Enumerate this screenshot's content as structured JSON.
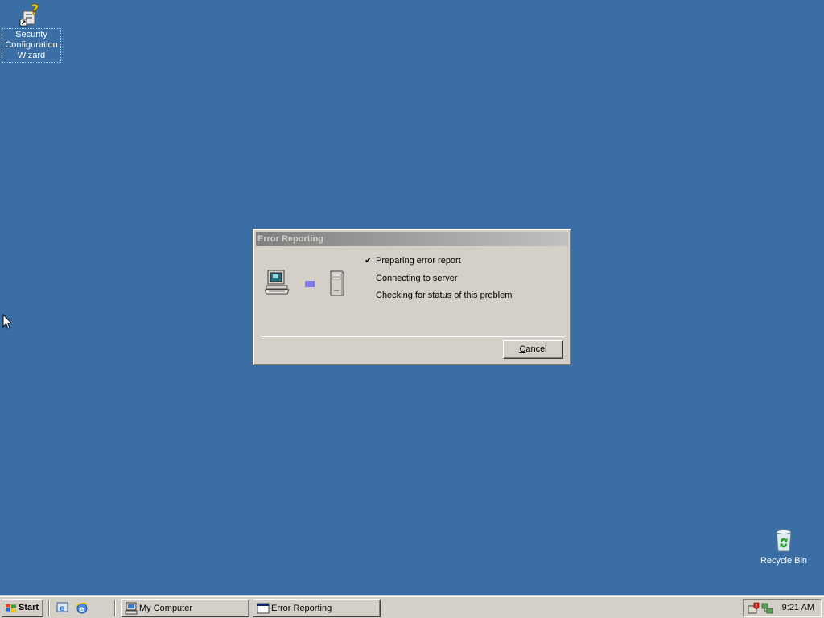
{
  "desktop": {
    "background": "#3a6ea5",
    "icons": [
      {
        "label": "Security Configuration Wizard",
        "icon": "security-wizard-icon"
      },
      {
        "label": "Recycle Bin",
        "icon": "recycle-bin-icon"
      }
    ]
  },
  "dialog": {
    "title": "Error Reporting",
    "steps": [
      {
        "label": "Preparing error report",
        "done": true
      },
      {
        "label": "Connecting to server",
        "done": false
      },
      {
        "label": "Checking for status of this problem",
        "done": false
      }
    ],
    "cancel_accel": "C",
    "cancel_rest": "ancel"
  },
  "taskbar": {
    "start_label": "Start",
    "quick_launch": [
      "show-desktop-icon",
      "internet-explorer-icon"
    ],
    "tasks": [
      {
        "label": "My Computer",
        "icon": "my-computer-icon"
      },
      {
        "label": "Error Reporting",
        "icon": "window-icon"
      }
    ],
    "clock": "9:21 AM"
  }
}
